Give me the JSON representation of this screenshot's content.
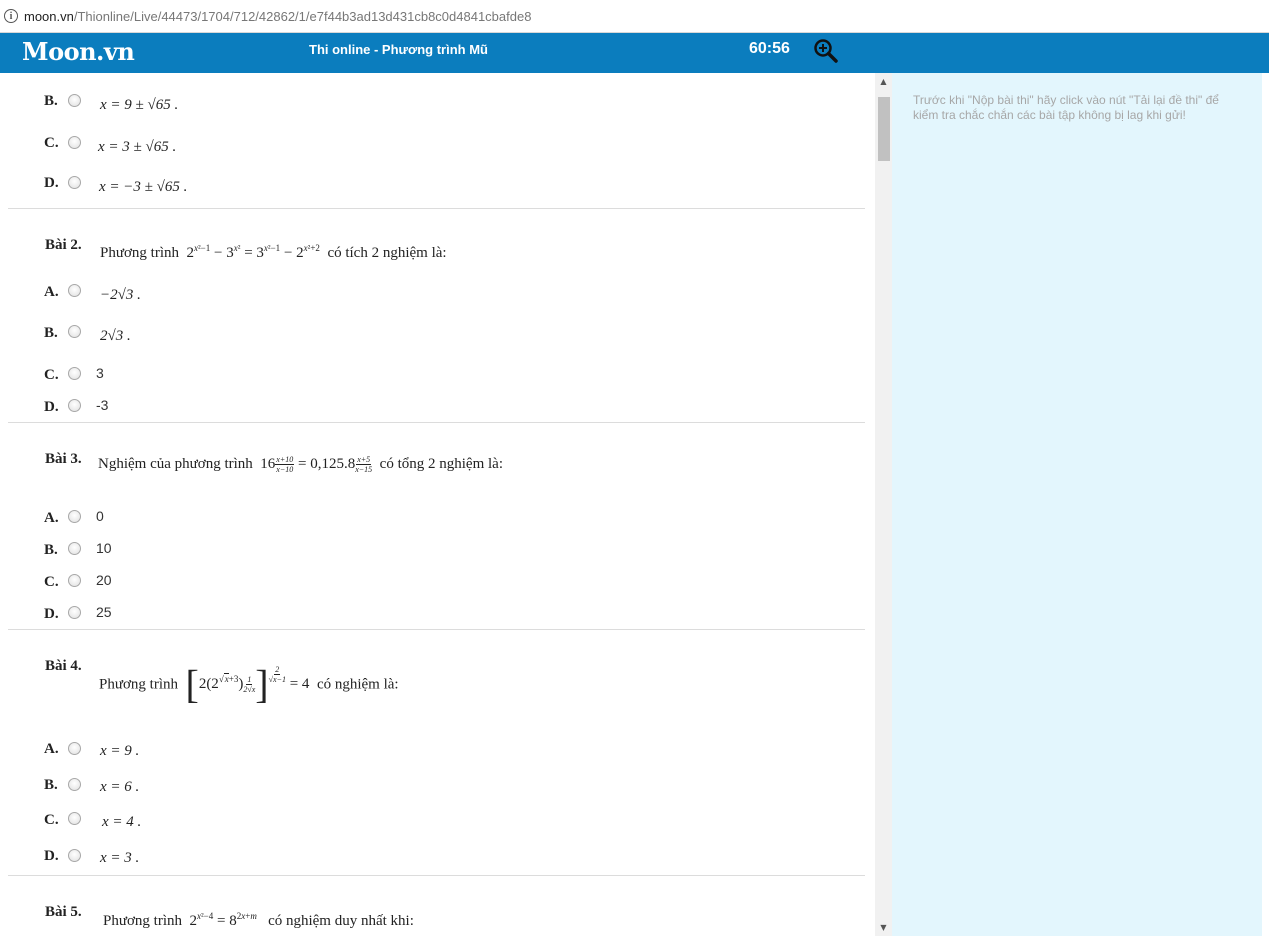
{
  "browser": {
    "url_host": "moon.vn",
    "url_path": "/Thionline/Live/44473/1704/712/42862/1/e7f44b3ad13d431cb8c0d4841cbafde8"
  },
  "header": {
    "logo": "Moon.vn",
    "title": "Thi online - Phương trình Mũ",
    "timer": "60:56"
  },
  "sidebar": {
    "note": "Trước khi \"Nộp bài thi\" hãy click vào nút \"Tải lại đề thi\" để kiểm tra chắc chắn các bài tập không bị lag khi gửi!"
  },
  "questions": [
    {
      "options": [
        {
          "label": "B.",
          "text": "x = 9 ± √65 ."
        },
        {
          "label": "C.",
          "text": "x = 3 ± √65 ."
        },
        {
          "label": "D.",
          "text": "x = −3 ± √65 ."
        }
      ]
    },
    {
      "label": "Bài 2.",
      "prefix": "Phương trình",
      "suffix": "có tích 2 nghiệm là:",
      "options": [
        {
          "label": "A.",
          "text": "−2√3 ."
        },
        {
          "label": "B.",
          "text": "2√3 ."
        },
        {
          "label": "C.",
          "text": "3"
        },
        {
          "label": "D.",
          "text": "-3"
        }
      ]
    },
    {
      "label": "Bài 3.",
      "prefix": "Nghiệm của phương trình",
      "mid": "= 0,125.8",
      "suffix": "có tổng 2 nghiệm là:",
      "options": [
        {
          "label": "A.",
          "text": "0"
        },
        {
          "label": "B.",
          "text": "10"
        },
        {
          "label": "C.",
          "text": "20"
        },
        {
          "label": "D.",
          "text": "25"
        }
      ]
    },
    {
      "label": "Bài 4.",
      "prefix": "Phương trình",
      "suffix": "có nghiệm là:",
      "options": [
        {
          "label": "A.",
          "text": "x = 9 ."
        },
        {
          "label": "B.",
          "text": "x = 6 ."
        },
        {
          "label": "C.",
          "text": "x = 4 ."
        },
        {
          "label": "D.",
          "text": "x = 3 ."
        }
      ]
    },
    {
      "label": "Bài 5.",
      "prefix": "Phương trình",
      "suffix": "có nghiệm duy nhất khi:"
    }
  ]
}
